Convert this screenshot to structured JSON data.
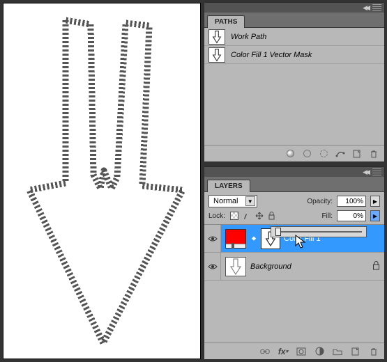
{
  "paths_panel": {
    "tab_label": "PATHS",
    "items": [
      {
        "label": "Work Path",
        "italic": true
      },
      {
        "label": "Color Fill 1 Vector Mask",
        "italic": true
      }
    ]
  },
  "layers_panel": {
    "tab_label": "LAYERS",
    "blend_mode": "Normal",
    "opacity_label": "Opacity:",
    "opacity_value": "100%",
    "lock_label": "Lock:",
    "fill_label": "Fill:",
    "fill_value": "0%",
    "layers": [
      {
        "name": "Color Fill 1",
        "type": "fill",
        "color": "#ff0000",
        "selected": true,
        "visible": true,
        "masked": true
      },
      {
        "name": "Background",
        "type": "background",
        "locked": true,
        "visible": true,
        "italic": true
      }
    ]
  }
}
